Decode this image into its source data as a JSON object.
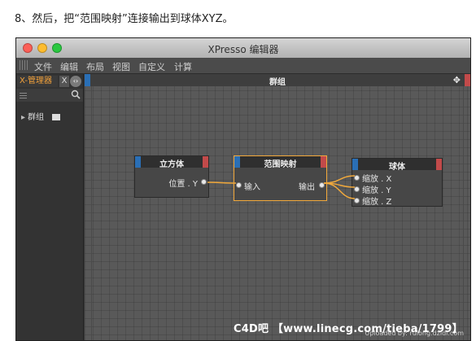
{
  "caption": "8、然后，把“范围映射”连接输出到球体XYZ。",
  "window": {
    "title": "XPresso 编辑器"
  },
  "menu": [
    "文件",
    "编辑",
    "布局",
    "视图",
    "自定义",
    "计算"
  ],
  "left_panel": {
    "tab_label": "X-管理器",
    "tab_x": "X",
    "tab_arrows": "‹›",
    "tree": [
      {
        "label": "群组"
      }
    ]
  },
  "group": {
    "title": "群组"
  },
  "nodes": {
    "cube": {
      "title": "立方体",
      "port": "位置 . Y"
    },
    "range": {
      "title": "范围映射",
      "input": "输入",
      "output": "输出"
    },
    "sphere": {
      "title": "球体",
      "ports": [
        "缩放 . X",
        "缩放 . Y",
        "缩放 . Z"
      ]
    }
  },
  "watermark": "C4D吧 【www.linecg.com/tieba/1799】",
  "corner_mark": "Uploaded by: rulong.dzidi.com",
  "colors": {
    "node_blue": "#2a6fb6",
    "node_red": "#c24a4a",
    "wire": "#f2a93b",
    "selected_outline": "#f2a93b"
  }
}
